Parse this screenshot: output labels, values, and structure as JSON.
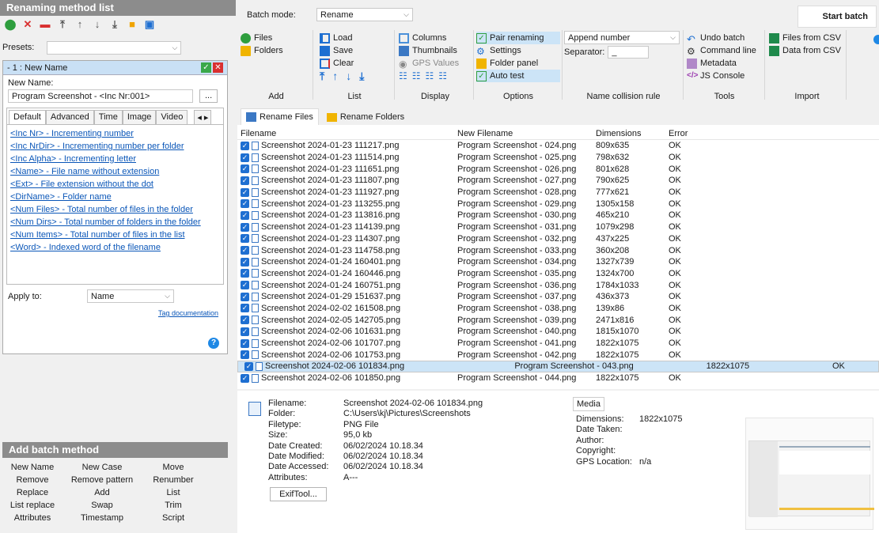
{
  "left": {
    "title": "Renaming method list",
    "presets_label": "Presets:",
    "method": {
      "header": "- 1 : New Name",
      "new_name_label": "New Name:",
      "new_name_value": "Program Screenshot - <Inc Nr:001>",
      "ellipsis": "...",
      "tabs": [
        "Default",
        "Advanced",
        "Time",
        "Image",
        "Video"
      ],
      "tags": [
        "<Inc Nr> - Incrementing number",
        "<Inc NrDir> - Incrementing number per folder",
        "<Inc Alpha> - Incrementing letter",
        "<Name> - File name without extension",
        "<Ext> - File extension without the dot",
        "<DirName> - Folder name",
        "<Num Files> - Total number of files in the folder",
        "<Num Dirs> - Total number of folders in the folder",
        "<Num Items> - Total number of files in the list",
        "<Word> - Indexed word of the filename"
      ],
      "tag_doc": "Tag documentation",
      "apply_to_label": "Apply to:",
      "apply_to_value": "Name"
    },
    "add_batch": {
      "title": "Add batch method",
      "items": [
        "New Name",
        "New Case",
        "Move",
        "Remove",
        "Remove pattern",
        "Renumber",
        "Replace",
        "Add",
        "List",
        "List replace",
        "Swap",
        "Trim",
        "Attributes",
        "Timestamp",
        "Script"
      ]
    }
  },
  "top": {
    "batch_mode_label": "Batch mode:",
    "batch_mode_value": "Rename",
    "start_batch": "Start batch",
    "add": {
      "files": "Files",
      "folders": "Folders",
      "label": "Add"
    },
    "list": {
      "load": "Load",
      "save": "Save",
      "clear": "Clear",
      "label": "List"
    },
    "display": {
      "columns": "Columns",
      "thumbnails": "Thumbnails",
      "gps": "GPS Values",
      "label": "Display"
    },
    "options": {
      "pair": "Pair renaming",
      "settings": "Settings",
      "folder_panel": "Folder panel",
      "auto_test": "Auto test",
      "label": "Options"
    },
    "collision": {
      "value": "Append number",
      "separator_label": "Separator:",
      "separator_value": "_",
      "label": "Name collision rule"
    },
    "tools": {
      "undo": "Undo batch",
      "cmd": "Command line",
      "meta": "Metadata",
      "js": "JS Console",
      "label": "Tools"
    },
    "import": {
      "csv_files": "Files from CSV",
      "csv_data": "Data from CSV",
      "label": "Import"
    }
  },
  "files": {
    "tabs": [
      "Rename Files",
      "Rename Folders"
    ],
    "columns": [
      "Filename",
      "New Filename",
      "Dimensions",
      "Error"
    ],
    "rows": [
      [
        "Screenshot 2024-01-23 111217.png",
        "Program Screenshot - 024.png",
        "809x635",
        "OK"
      ],
      [
        "Screenshot 2024-01-23 111514.png",
        "Program Screenshot - 025.png",
        "798x632",
        "OK"
      ],
      [
        "Screenshot 2024-01-23 111651.png",
        "Program Screenshot - 026.png",
        "801x628",
        "OK"
      ],
      [
        "Screenshot 2024-01-23 111807.png",
        "Program Screenshot - 027.png",
        "790x625",
        "OK"
      ],
      [
        "Screenshot 2024-01-23 111927.png",
        "Program Screenshot - 028.png",
        "777x621",
        "OK"
      ],
      [
        "Screenshot 2024-01-23 113255.png",
        "Program Screenshot - 029.png",
        "1305x158",
        "OK"
      ],
      [
        "Screenshot 2024-01-23 113816.png",
        "Program Screenshot - 030.png",
        "465x210",
        "OK"
      ],
      [
        "Screenshot 2024-01-23 114139.png",
        "Program Screenshot - 031.png",
        "1079x298",
        "OK"
      ],
      [
        "Screenshot 2024-01-23 114307.png",
        "Program Screenshot - 032.png",
        "437x225",
        "OK"
      ],
      [
        "Screenshot 2024-01-23 114758.png",
        "Program Screenshot - 033.png",
        "360x208",
        "OK"
      ],
      [
        "Screenshot 2024-01-24 160401.png",
        "Program Screenshot - 034.png",
        "1327x739",
        "OK"
      ],
      [
        "Screenshot 2024-01-24 160446.png",
        "Program Screenshot - 035.png",
        "1324x700",
        "OK"
      ],
      [
        "Screenshot 2024-01-24 160751.png",
        "Program Screenshot - 036.png",
        "1784x1033",
        "OK"
      ],
      [
        "Screenshot 2024-01-29 151637.png",
        "Program Screenshot - 037.png",
        "436x373",
        "OK"
      ],
      [
        "Screenshot 2024-02-02 161508.png",
        "Program Screenshot - 038.png",
        "139x86",
        "OK"
      ],
      [
        "Screenshot 2024-02-05 142705.png",
        "Program Screenshot - 039.png",
        "2471x816",
        "OK"
      ],
      [
        "Screenshot 2024-02-06 101631.png",
        "Program Screenshot - 040.png",
        "1815x1070",
        "OK"
      ],
      [
        "Screenshot 2024-02-06 101707.png",
        "Program Screenshot - 041.png",
        "1822x1075",
        "OK"
      ],
      [
        "Screenshot 2024-02-06 101753.png",
        "Program Screenshot - 042.png",
        "1822x1075",
        "OK"
      ],
      [
        "Screenshot 2024-02-06 101834.png",
        "Program Screenshot - 043.png",
        "1822x1075",
        "OK"
      ],
      [
        "Screenshot 2024-02-06 101850.png",
        "Program Screenshot - 044.png",
        "1822x1075",
        "OK"
      ]
    ],
    "selected_index": 19
  },
  "info": {
    "keys": [
      "Filename:",
      "Folder:",
      "Filetype:",
      "Size:",
      "Date Created:",
      "Date Modified:",
      "Date Accessed:",
      "Attributes:"
    ],
    "values": [
      "Screenshot 2024-02-06 101834.png",
      "C:\\Users\\kj\\Pictures\\Screenshots",
      "PNG File",
      "95,0 kb",
      "06/02/2024 10.18.34",
      "06/02/2024 10.18.34",
      "06/02/2024 10.18.34",
      "A---"
    ],
    "exif_button": "ExifTool...",
    "media_tab": "Media",
    "media_keys": [
      "Dimensions:",
      "Date Taken:",
      "Author:",
      "Copyright:",
      "GPS Location:"
    ],
    "media_values": [
      "1822x1075",
      "",
      "",
      "",
      "n/a"
    ]
  },
  "colors": {
    "accent": "#1e6fd1",
    "header_gray": "#8c8c8c",
    "selected_row": "#cce4f7",
    "link": "#0a56b8"
  }
}
